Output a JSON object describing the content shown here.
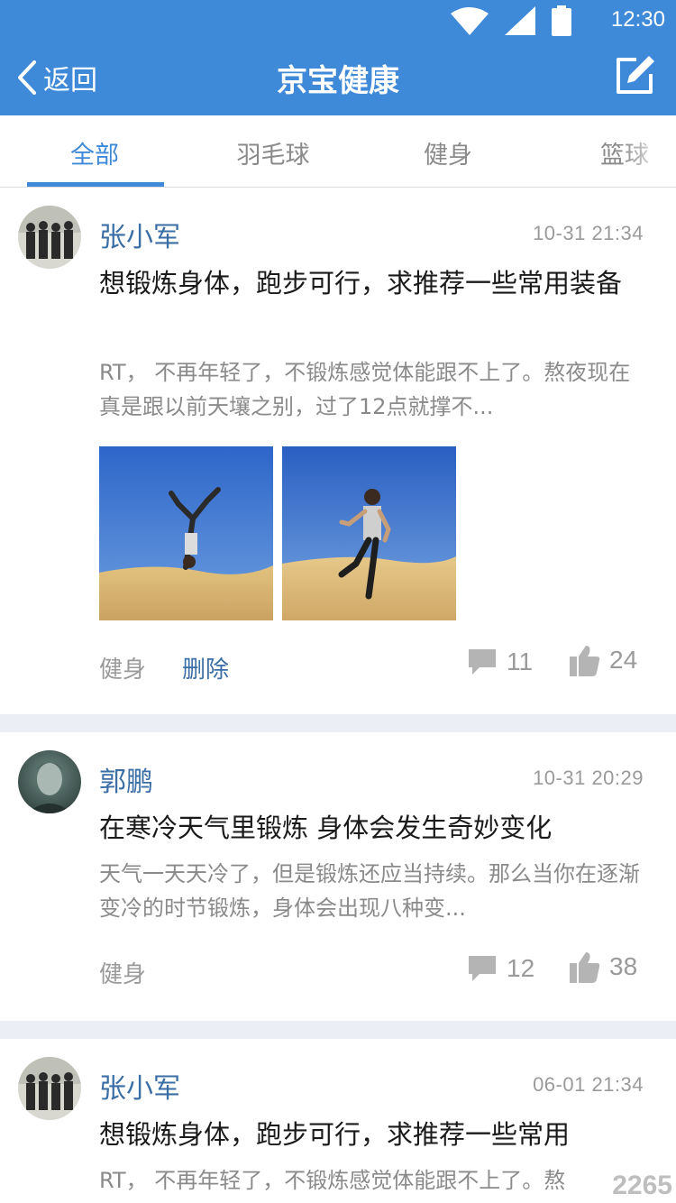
{
  "status_bar": {
    "time": "12:30"
  },
  "nav": {
    "back_label": "返回",
    "title": "京宝健康"
  },
  "tabs": [
    {
      "label": "全部",
      "active": true
    },
    {
      "label": "羽毛球",
      "active": false
    },
    {
      "label": "健身",
      "active": false
    },
    {
      "label": "篮球",
      "active": false
    }
  ],
  "posts": [
    {
      "author": "张小军",
      "time": "10-31 21:34",
      "title": "想锻炼身体，跑步可行，求推荐一些常用装备",
      "summary": "RT， 不再年轻了，不锻炼感觉体能跟不上了。熬夜现在真是跟以前天壤之别，过了12点就撑不...",
      "tag": "健身",
      "delete_label": "删除",
      "comments": "11",
      "likes": "24"
    },
    {
      "author": "郭鹏",
      "time": "10-31 20:29",
      "title": "在寒冷天气里锻炼 身体会发生奇妙变化",
      "summary": "天气一天天冷了，但是锻炼还应当持续。那么当你在逐渐变冷的时节锻炼，身体会出现八种变...",
      "tag": "健身",
      "comments": "12",
      "likes": "38"
    },
    {
      "author": "张小军",
      "time": "06-01 21:34",
      "title": "想锻炼身体，跑步可行，求推荐一些常用",
      "summary": "RT， 不再年轻了，不锻炼感觉体能跟不上了。熬"
    }
  ],
  "watermark": "2265",
  "colors": {
    "primary": "#3f8ad8",
    "author": "#3a6ea5",
    "muted": "#9a9a9a",
    "background": "#ebeef5"
  }
}
